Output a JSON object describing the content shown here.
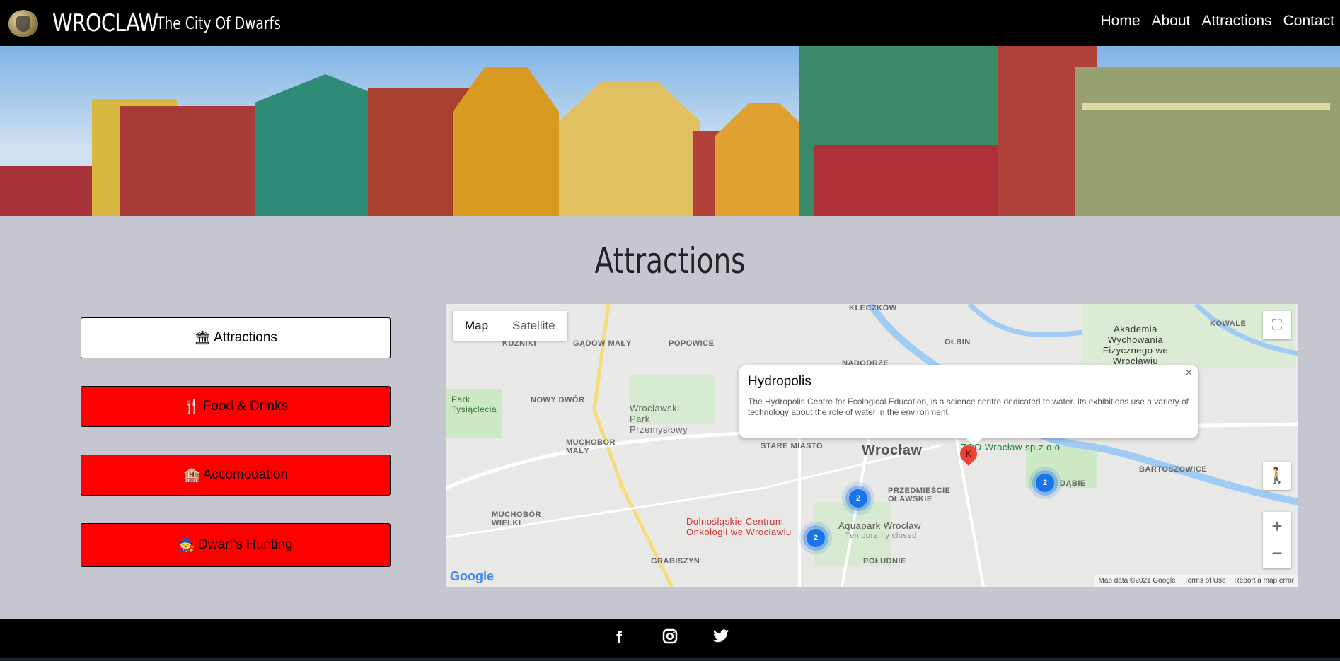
{
  "nav": {
    "brand": "WROCLAW",
    "tagline": "The City Of Dwarfs",
    "links": [
      "Home",
      "About",
      "Attractions",
      "Contact"
    ]
  },
  "page_title": "Attractions",
  "categories": [
    {
      "label": "Attractions",
      "icon": "🏛",
      "active": true
    },
    {
      "label": "Food & Drinks",
      "icon": "🍴",
      "active": false
    },
    {
      "label": "Accomodation",
      "icon": "🏨",
      "active": false
    },
    {
      "label": "Dwarf's Hunting",
      "icon": "🧙",
      "active": false
    }
  ],
  "map": {
    "type_buttons": [
      "Map",
      "Satellite"
    ],
    "selected": "Map",
    "popup": {
      "title": "Hydropolis",
      "text": "The Hydropolis Centre for Ecological Education, is a science centre dedicated to water. Its exhibitions use a variety of technology about the role of water in the environment.",
      "close": "×"
    },
    "labels": [
      "KLECZKÓW",
      "POPOWICE",
      "GĄDÓW MAŁY",
      "KUŹNIKI",
      "NOWY DWÓR",
      "Wrocławski Park Przemysłowy",
      "MUCHOBÓR MAŁY",
      "MUCHOBÓR WIELKI",
      "Park Tysiąclecia",
      "STARE MIASTO",
      "Wrocław",
      "ZOO Wrocław sp.z o.o",
      "PRZEDMIEŚCIE OŁAWSKIE",
      "Aquapark Wrocław",
      "Temporarily closed",
      "Dolnośląskie Centrum Onkologii we Wrocławiu",
      "POŁUDNIE",
      "GRABISZYN",
      "DĄBIE",
      "BARTOSZOWICE",
      "KOWALE",
      "Akademia Wychowania Fizycznego we Wrocławiu",
      "OŁBIN",
      "NADODRZE"
    ],
    "clusters": [
      "2",
      "2",
      "2"
    ],
    "marker": "K",
    "attribution": [
      "Map data ©2021 Google",
      "Terms of Use",
      "Report a map error"
    ],
    "google": "Google"
  },
  "footer": {
    "icons": [
      "facebook-icon",
      "instagram-icon",
      "twitter-icon"
    ]
  }
}
